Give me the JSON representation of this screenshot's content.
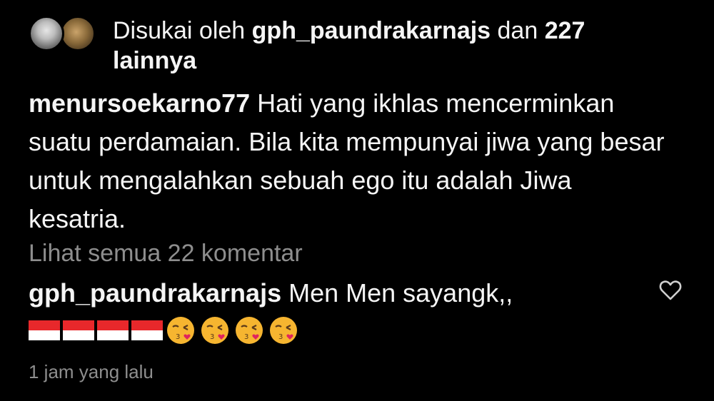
{
  "likes": {
    "prefix": "Disukai oleh ",
    "user": "gph_paundrakarnajs",
    "conj": " dan ",
    "count": "227",
    "suffix": "lainnya"
  },
  "caption": {
    "username": "menursoekarno77",
    "text": " Hati yang ikhlas mencerminkan suatu perdamaian. Bila kita mempunyai jiwa yang besar untuk mengalahkan sebuah ego itu adalah Jiwa kesatria."
  },
  "view_all_comments": "Lihat semua 22 komentar",
  "comment": {
    "username": "gph_paundrakarnajs",
    "text": " Men Men sayangk,,",
    "emojis": [
      "indonesia-flag",
      "indonesia-flag",
      "indonesia-flag",
      "indonesia-flag",
      "kissing-heart-face",
      "kissing-heart-face",
      "kissing-heart-face",
      "kissing-heart-face"
    ]
  },
  "timestamp": "1 jam yang lalu",
  "icons": {
    "like": "heart-outline-icon"
  },
  "colors": {
    "background": "#000000",
    "text": "#f5f5f5",
    "muted": "#8e8e8e",
    "flag_red": "#e8282b",
    "flag_white": "#ffffff",
    "emoji_yellow": "#f6b530",
    "heart_red": "#e0245e"
  }
}
